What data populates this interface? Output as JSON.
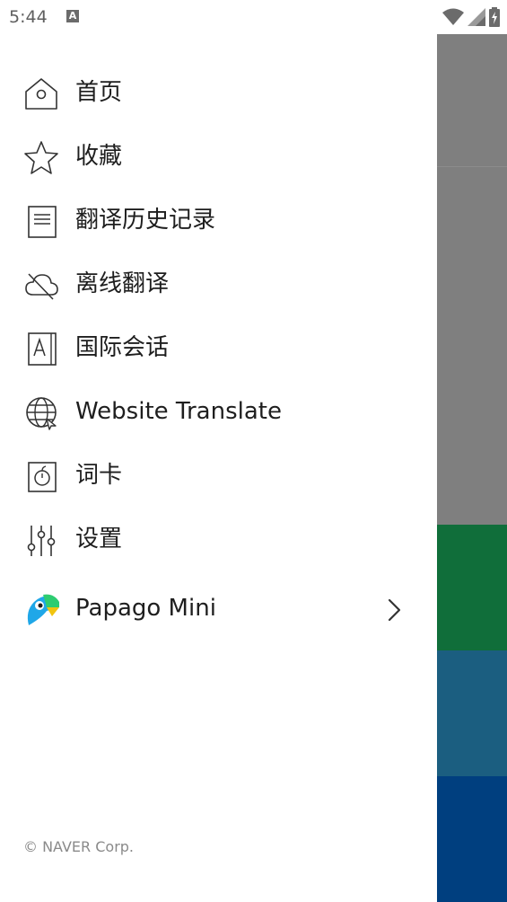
{
  "status_bar": {
    "time": "5:44",
    "notification_glyph": "A",
    "icons": [
      "wifi-icon",
      "signal-icon",
      "battery-icon"
    ]
  },
  "drawer": {
    "items": [
      {
        "label": "首页",
        "icon": "home-icon"
      },
      {
        "label": "收藏",
        "icon": "star-icon"
      },
      {
        "label": "翻译历史记录",
        "icon": "document-icon"
      },
      {
        "label": "离线翻译",
        "icon": "cloud-off-icon"
      },
      {
        "label": "国际会话",
        "icon": "phrasebook-icon"
      },
      {
        "label": "Website Translate",
        "icon": "globe-icon"
      },
      {
        "label": "词卡",
        "icon": "word-card-icon"
      },
      {
        "label": "设置",
        "icon": "sliders-icon"
      },
      {
        "label": "Papago Mini",
        "icon": "papago-parrot-icon"
      }
    ],
    "footer": "© NAVER Corp."
  },
  "colors": {
    "scrim": "#7f7f7f",
    "band_green": "#106e3a",
    "band_teal": "#1b5e80",
    "band_navy": "#003f7f",
    "text": "#1e1e1e",
    "footer_text": "#8a8a8a",
    "parrot_blue": "#1fa7e8",
    "parrot_green": "#2ecc71"
  }
}
